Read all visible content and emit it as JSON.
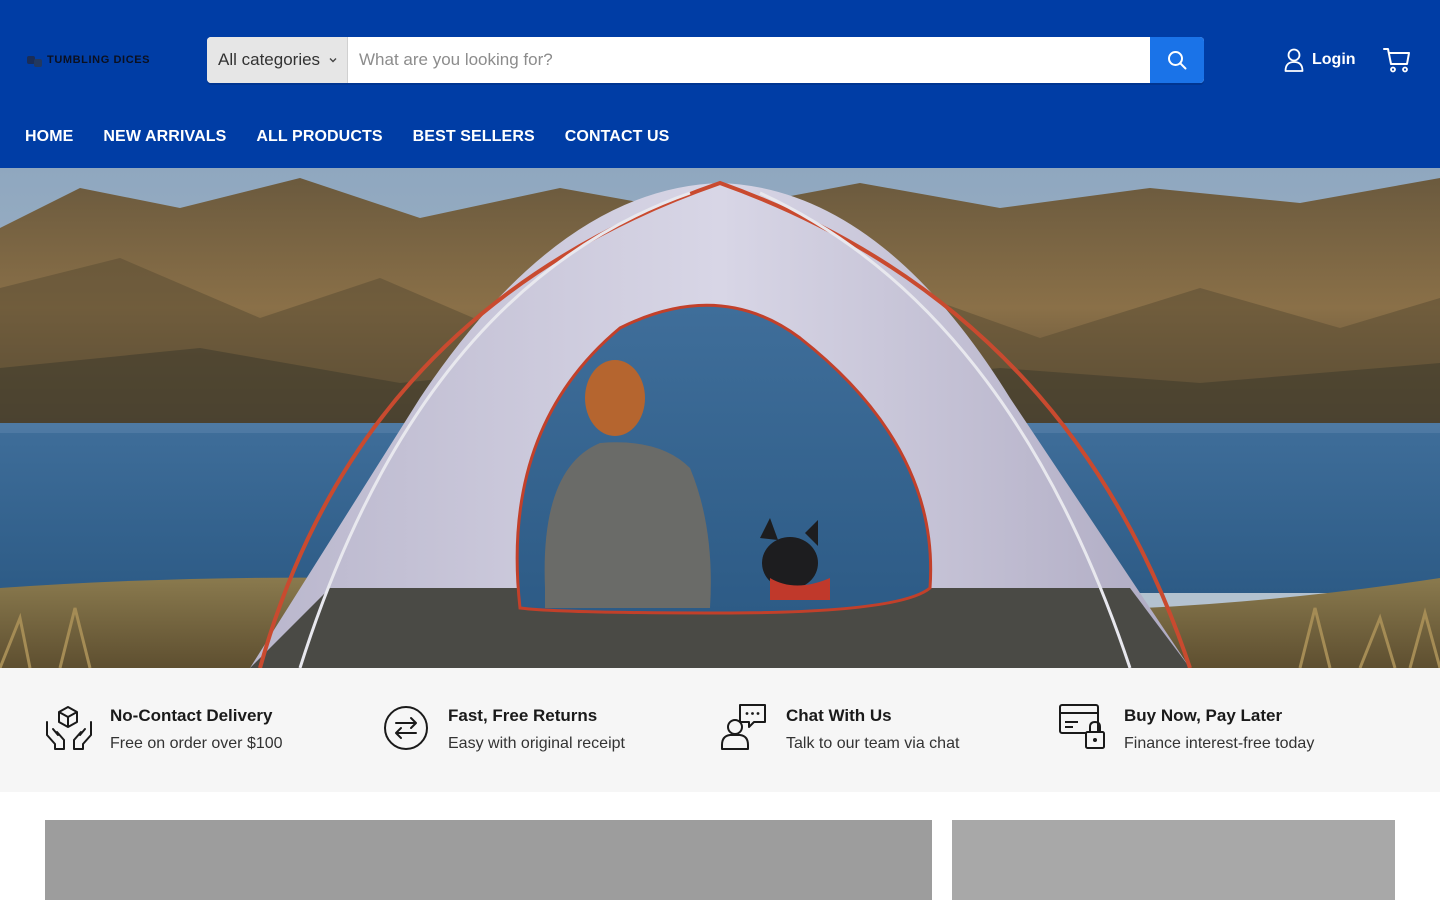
{
  "header": {
    "logo_text": "TUMBLING DICES",
    "search": {
      "category_selected": "All categories",
      "placeholder": "What are you looking for?",
      "value": ""
    },
    "login_label": "Login",
    "colors": {
      "header_bg": "#003da5",
      "search_button": "#1a73e8"
    }
  },
  "nav": {
    "items": [
      {
        "label": "HOME"
      },
      {
        "label": "NEW ARRIVALS"
      },
      {
        "label": "ALL PRODUCTS"
      },
      {
        "label": "BEST SELLERS"
      },
      {
        "label": "CONTACT US"
      }
    ]
  },
  "hero": {
    "image": "tent-by-lake-with-woman-and-dog"
  },
  "features": [
    {
      "icon": "delivery-box-hands-icon",
      "title": "No-Contact Delivery",
      "subtitle": "Free on order over $100"
    },
    {
      "icon": "returns-arrows-icon",
      "title": "Fast, Free Returns",
      "subtitle": "Easy with original receipt"
    },
    {
      "icon": "chat-person-icon",
      "title": "Chat With Us",
      "subtitle": "Talk to our team via chat"
    },
    {
      "icon": "card-lock-icon",
      "title": "Buy Now, Pay Later",
      "subtitle": "Finance interest-free today"
    }
  ]
}
